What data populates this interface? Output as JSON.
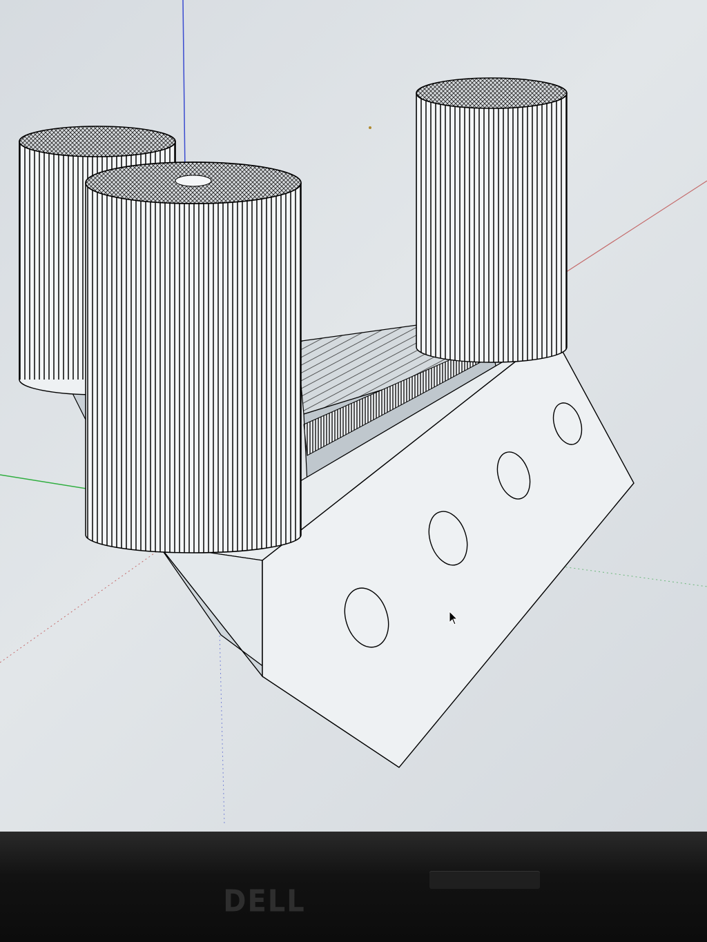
{
  "monitor": {
    "brand_logo": "DELL"
  },
  "viewport": {
    "background_color": "#dfe3e6",
    "model_fill": "#f3f5f6",
    "model_shade": "#c9d0d6",
    "edge_color": "#000000",
    "axis_colors": {
      "blue_axis": "#3a4bd0",
      "green_axis": "#2fae3f",
      "red_axis": "#c46a6a"
    },
    "icons": [
      "mouse-cursor-icon"
    ]
  }
}
